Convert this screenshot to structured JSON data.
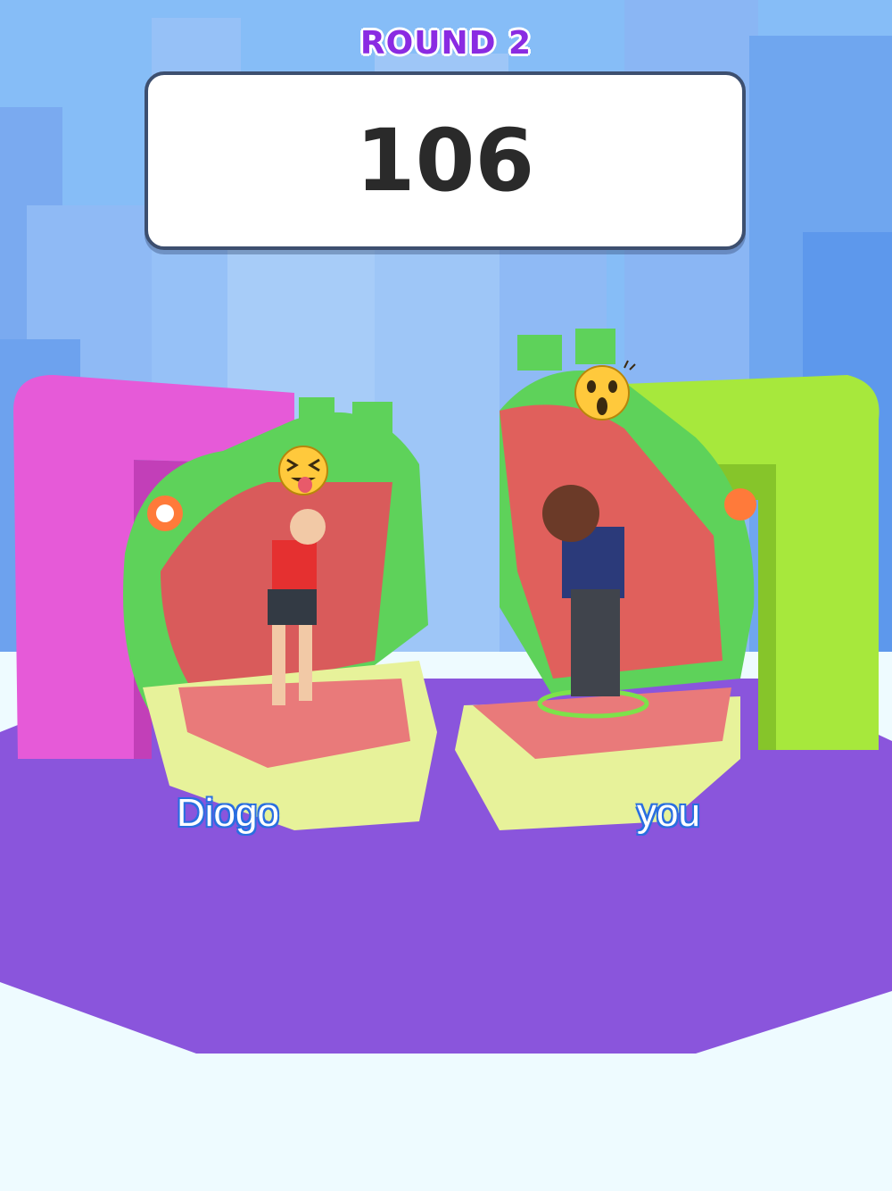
{
  "hud": {
    "round_label": "ROUND 2",
    "score": "106"
  },
  "players": [
    {
      "name": "Diogo",
      "emoji": "tongue-out-face-icon"
    },
    {
      "name": "you",
      "emoji": "surprised-face-icon"
    }
  ],
  "colors": {
    "sky": "#7fb4f5",
    "arena_floor": "#8a55dc",
    "left_gate": "#e65ad8",
    "right_gate": "#a7e83c",
    "croc_green": "#5ed25a",
    "croc_mouth": "#e06a66",
    "round_text": "#8a2be2"
  }
}
